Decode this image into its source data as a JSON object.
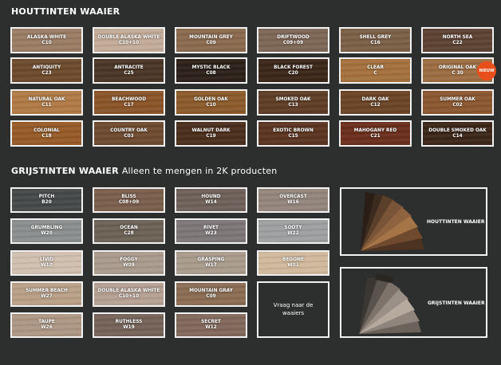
{
  "sections": {
    "wood_title": "HOUTTINTEN WAAIER",
    "grey_title": "GRIJSTINTEN WAAIER",
    "grey_subtitle": "Alleen te mengen in 2K producten"
  },
  "wood_swatches": [
    {
      "name": "ALASKA WHITE",
      "code": "C10",
      "color": "#9a7c64"
    },
    {
      "name": "DOUBLE ALASKA WHITE",
      "code": "C10+10",
      "color": "#c3ab98"
    },
    {
      "name": "MOUNTAIN GREY",
      "code": "C09",
      "color": "#8a6a4e"
    },
    {
      "name": "DRIFTWOOD",
      "code": "C09+09",
      "color": "#7d6655"
    },
    {
      "name": "SHELL GREY",
      "code": "C16",
      "color": "#7a5f46"
    },
    {
      "name": "NORTH SEA",
      "code": "C22",
      "color": "#5d4232"
    },
    {
      "name": "ANTIQUITY",
      "code": "C23",
      "color": "#6d4a2c"
    },
    {
      "name": "ANTRACITE",
      "code": "C25",
      "color": "#4a3526"
    },
    {
      "name": "MYSTIC BLACK",
      "code": "C08",
      "color": "#2c2019"
    },
    {
      "name": "BLACK FOREST",
      "code": "C20",
      "color": "#3a2619"
    },
    {
      "name": "CLEAR",
      "code": "C",
      "color": "#a4703d"
    },
    {
      "name": "ORIGINAL OAK",
      "code": "C 30",
      "color": "#9c6d42"
    },
    {
      "name": "NATURAL OAK",
      "code": "C11",
      "color": "#b07a45"
    },
    {
      "name": "BEACHWOOD",
      "code": "C17",
      "color": "#8a5429"
    },
    {
      "name": "GOLDEN OAK",
      "code": "C10",
      "color": "#8b5a2a"
    },
    {
      "name": "SMOKED OAK",
      "code": "C13",
      "color": "#5e3d26"
    },
    {
      "name": "DARK OAK",
      "code": "C12",
      "color": "#6b4426"
    },
    {
      "name": "SUMMER OAK",
      "code": "C02",
      "color": "#8a5730"
    },
    {
      "name": "COLONIAL",
      "code": "C18",
      "color": "#965a27"
    },
    {
      "name": "COUNTRY OAK",
      "code": "C03",
      "color": "#6d4a2f"
    },
    {
      "name": "WALNUT DARK",
      "code": "C19",
      "color": "#4b2e1c"
    },
    {
      "name": "EXOTIC BROWN",
      "code": "C15",
      "color": "#5b3421"
    },
    {
      "name": "MAHOGANY RED",
      "code": "C21",
      "color": "#6a2e1c"
    },
    {
      "name": "DOUBLE SMOKED OAK",
      "code": "C14",
      "color": "#3b2619"
    }
  ],
  "new_badge": "NIEUW",
  "grey_swatches": [
    {
      "name": "PITCH",
      "code": "B20",
      "color": "#454849"
    },
    {
      "name": "BLISS",
      "code": "C08+09",
      "color": "#7a5e4c"
    },
    {
      "name": "HOUND",
      "code": "W14",
      "color": "#6e6059"
    },
    {
      "name": "OVERCAST",
      "code": "W16",
      "color": "#93857c"
    },
    {
      "name": "GRUMBLING",
      "code": "W20",
      "color": "#8b8e8e"
    },
    {
      "name": "OCEAN",
      "code": "C28",
      "color": "#6c6155"
    },
    {
      "name": "RIVET",
      "code": "W23",
      "color": "#7c7677"
    },
    {
      "name": "SOOTY",
      "code": "W22",
      "color": "#9d9fa0"
    },
    {
      "name": "LIVID",
      "code": "W10",
      "color": "#cfbfae"
    },
    {
      "name": "FOGGY",
      "code": "W09",
      "color": "#a99a8d"
    },
    {
      "name": "GRASPING",
      "code": "W17",
      "color": "#a89b8c"
    },
    {
      "name": "BEGONE",
      "code": "W01",
      "color": "#d0b89b"
    },
    {
      "name": "SUMMER BEACH",
      "code": "W27",
      "color": "#b89f87"
    },
    {
      "name": "DOUBLE ALASKA WHITE",
      "code": "C10+10",
      "color": "#b5a093"
    },
    {
      "name": "MOUNTAIN GRAY",
      "code": "C09",
      "color": "#8a6c52"
    },
    {
      "name": "TAUPE",
      "code": "W26",
      "color": "#ad9684"
    },
    {
      "name": "RUTHLESS",
      "code": "W19",
      "color": "#756258"
    },
    {
      "name": "SECRET",
      "code": "W12",
      "color": "#81685a"
    }
  ],
  "ask_box": "Vraag naar de waaiers",
  "fans": {
    "wood_label": "HOUTTINTEN WAAIER",
    "grey_label": "GRIJSTINTEN WAAIER"
  }
}
